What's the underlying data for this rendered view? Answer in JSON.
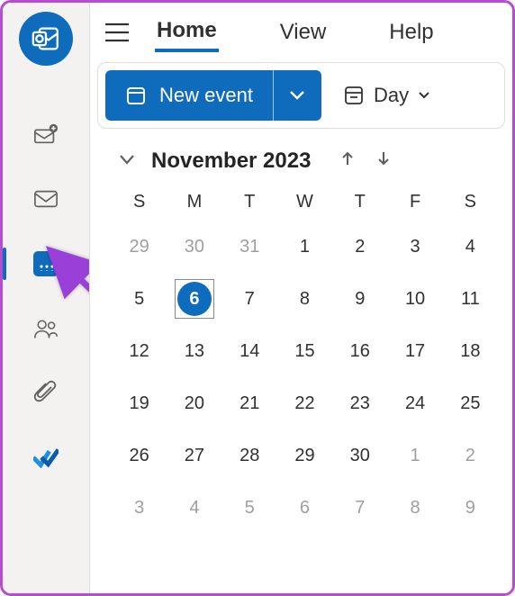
{
  "tabs": {
    "home": "Home",
    "view": "View",
    "help": "Help"
  },
  "ribbon": {
    "new_event": "New event",
    "view_mode": "Day"
  },
  "calendar": {
    "month_label": "November 2023",
    "dow": [
      "S",
      "M",
      "T",
      "W",
      "T",
      "F",
      "S"
    ],
    "today": 6,
    "weeks": [
      [
        {
          "n": 29,
          "o": true
        },
        {
          "n": 30,
          "o": true
        },
        {
          "n": 31,
          "o": true
        },
        {
          "n": 1
        },
        {
          "n": 2
        },
        {
          "n": 3
        },
        {
          "n": 4
        }
      ],
      [
        {
          "n": 5
        },
        {
          "n": 6,
          "today": true
        },
        {
          "n": 7
        },
        {
          "n": 8
        },
        {
          "n": 9
        },
        {
          "n": 10
        },
        {
          "n": 11
        }
      ],
      [
        {
          "n": 12
        },
        {
          "n": 13
        },
        {
          "n": 14
        },
        {
          "n": 15
        },
        {
          "n": 16
        },
        {
          "n": 17
        },
        {
          "n": 18
        }
      ],
      [
        {
          "n": 19
        },
        {
          "n": 20
        },
        {
          "n": 21
        },
        {
          "n": 22
        },
        {
          "n": 23
        },
        {
          "n": 24
        },
        {
          "n": 25
        }
      ],
      [
        {
          "n": 26
        },
        {
          "n": 27
        },
        {
          "n": 28
        },
        {
          "n": 29
        },
        {
          "n": 30
        },
        {
          "n": 1,
          "o": true
        },
        {
          "n": 2,
          "o": true
        }
      ],
      [
        {
          "n": 3,
          "o": true
        },
        {
          "n": 4,
          "o": true
        },
        {
          "n": 5,
          "o": true
        },
        {
          "n": 6,
          "o": true
        },
        {
          "n": 7,
          "o": true
        },
        {
          "n": 8,
          "o": true
        },
        {
          "n": 9,
          "o": true
        }
      ]
    ]
  }
}
